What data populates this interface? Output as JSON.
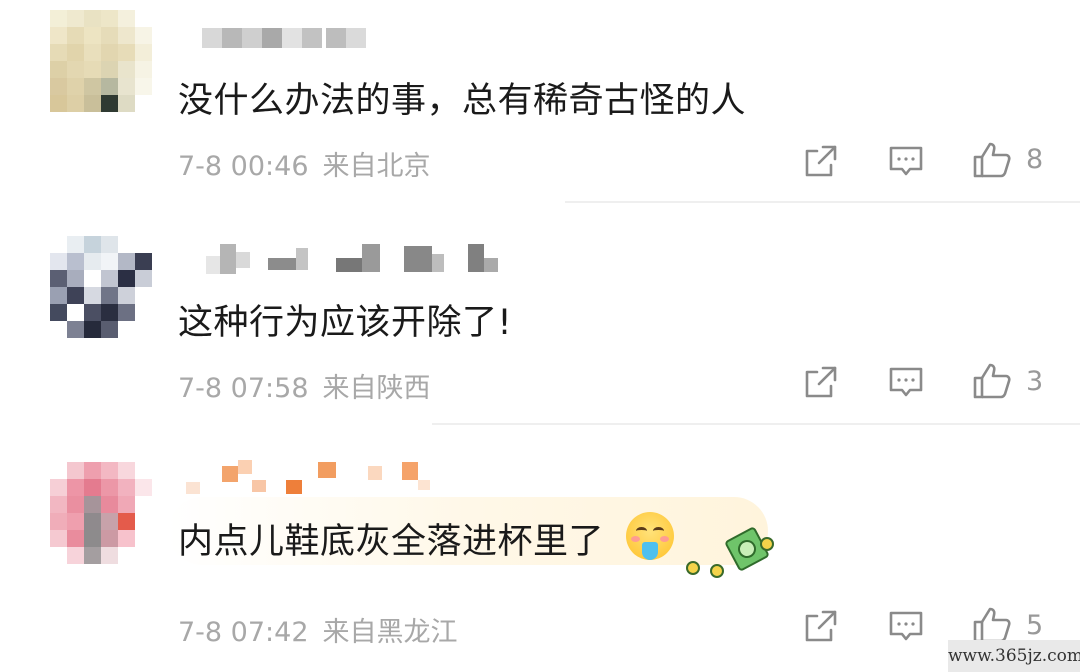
{
  "comments": [
    {
      "text": "没什么办法的事，总有稀奇古怪的人",
      "date": "7-8 00:46",
      "location": "来自北京",
      "likes": "8"
    },
    {
      "text": "这种行为应该开除了!",
      "date": "7-8 07:58",
      "location": "来自陕西",
      "likes": "3"
    },
    {
      "text": "内点儿鞋底灰全落进杯里了",
      "date": "7-8 07:42",
      "location": "来自黑龙江",
      "likes": "5"
    }
  ],
  "icons": {
    "share": "share-icon",
    "reply": "comment-icon",
    "like": "thumbs-up-icon"
  },
  "watermark": "www.365jz.com"
}
